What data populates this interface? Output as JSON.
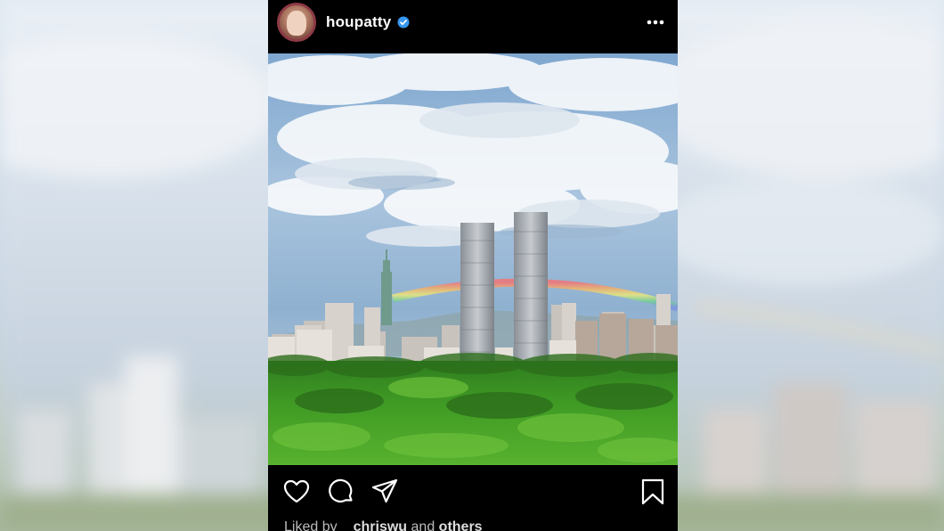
{
  "post": {
    "username": "houpatty",
    "verified": true,
    "likes": {
      "prefix": "Liked by",
      "user": "chriswu",
      "connector": "and",
      "others": "others"
    }
  },
  "colors": {
    "verified_badge": "#3897f0",
    "post_background": "#000000",
    "text": "#ffffff"
  },
  "icons": {
    "header": [
      "verified-badge-icon",
      "more-options-icon"
    ],
    "actions": [
      "heart-icon",
      "comment-icon",
      "share-icon",
      "bookmark-icon"
    ]
  }
}
